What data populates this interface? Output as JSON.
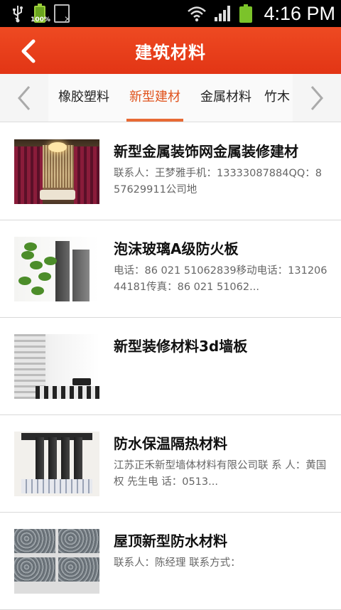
{
  "status_bar": {
    "time": "4:16 PM",
    "battery_percent": "100%",
    "icons": [
      "usb-icon",
      "battery-icon",
      "document-icon",
      "wifi-icon",
      "signal-icon",
      "battery-icon"
    ]
  },
  "header": {
    "title": "建筑材料",
    "back_icon": "chevron-left-icon"
  },
  "tabs": {
    "items": [
      {
        "label": "橡胶塑料",
        "active": false
      },
      {
        "label": "新型建材",
        "active": true
      },
      {
        "label": "金属材料",
        "active": false
      },
      {
        "label": "竹木",
        "active": false
      }
    ],
    "prev_icon": "chevron-left-icon",
    "next_icon": "chevron-right-icon"
  },
  "list": [
    {
      "title": "新型金属装饰网金属装修建材",
      "desc": "联系人：王梦雅手机：13333087884QQ：857629911公司地"
    },
    {
      "title": "泡沫玻璃A级防火板",
      "desc": "电话：86 021 51062839移动电话：13120644181传真：86 021 51062..."
    },
    {
      "title": "新型装修材料3d墙板",
      "desc": ""
    },
    {
      "title": "防水保温隔热材料",
      "desc": "江苏正禾新型墙体材料有限公司联 系 人：黄国权 先生电 话：0513..."
    },
    {
      "title": "屋顶新型防水材料",
      "desc": "联系人：陈经理 联系方式："
    }
  ],
  "colors": {
    "header_bg": "#ea3a1c",
    "tab_active": "#e0531d"
  }
}
